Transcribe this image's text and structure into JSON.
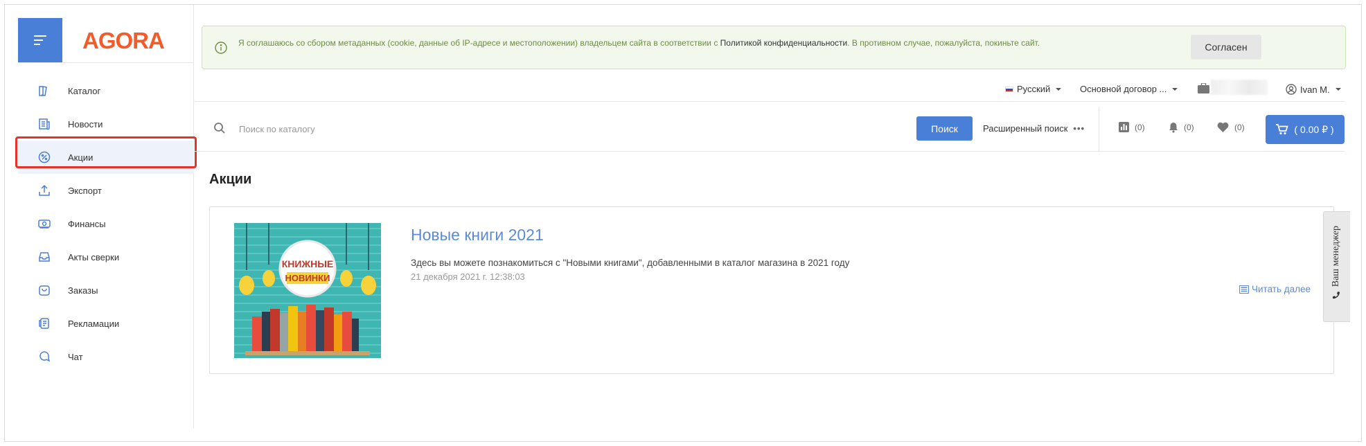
{
  "brand": {
    "logo_text": "AGORA",
    "logo_color": "#f25b2a",
    "accent": "#4a7fd8"
  },
  "sidebar": {
    "items": [
      {
        "label": "Каталог",
        "icon": "catalog-icon"
      },
      {
        "label": "Новости",
        "icon": "news-icon"
      },
      {
        "label": "Акции",
        "icon": "percent-icon",
        "active": true
      },
      {
        "label": "Экспорт",
        "icon": "upload-icon"
      },
      {
        "label": "Финансы",
        "icon": "money-icon"
      },
      {
        "label": "Акты сверки",
        "icon": "inbox-icon"
      },
      {
        "label": "Заказы",
        "icon": "bag-icon"
      },
      {
        "label": "Рекламации",
        "icon": "document-icon"
      },
      {
        "label": "Чат",
        "icon": "chat-icon"
      }
    ]
  },
  "consent": {
    "text_before": "Я соглашаюсь со сбором метаданных (cookie, данные об IP-адресе и местоположении) владельцем сайта в соответствии с ",
    "link_text": "Политикой конфиденциальности",
    "text_after": ". В противном случае, пожалуйста, покиньте сайт.",
    "button_label": "Согласен"
  },
  "topbar": {
    "language": "Русский",
    "contract": "Основной договор ...",
    "user": "Ivan M."
  },
  "search": {
    "placeholder": "Поиск по каталогу",
    "button_label": "Поиск",
    "advanced_label": "Расширенный поиск",
    "compare_count": "(0)",
    "notifications_count": "(0)",
    "favorites_count": "(0)",
    "cart_label": "( 0.00 ₽ )"
  },
  "page": {
    "title": "Акции",
    "promo": {
      "title": "Новые книги 2021",
      "description": "Здесь вы можете познакомиться с \"Новыми книгами\", добавленными в каталог магазина в 2021 году",
      "date": "21 декабря 2021 г. 12:38:03",
      "read_more": "Читать далее",
      "image_text_line1": "КНИЖНЫЕ",
      "image_text_line2": "НОВИНКИ"
    }
  },
  "manager_tab": {
    "label": "Ваш менеджер"
  }
}
